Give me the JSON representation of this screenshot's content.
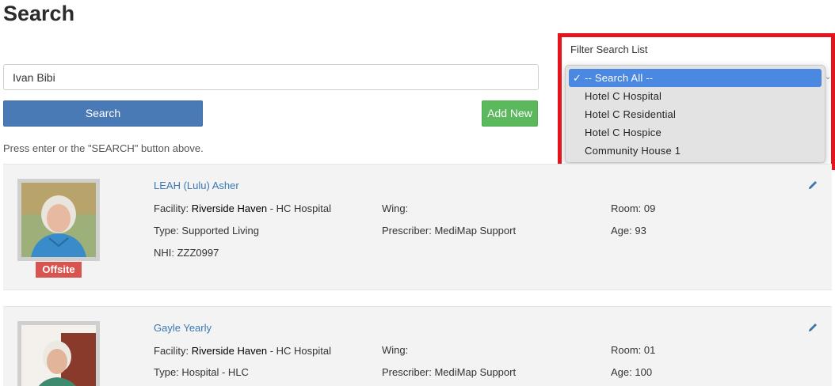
{
  "page": {
    "title": "Search"
  },
  "search": {
    "value": "Ivan Bibi",
    "button_label": "Search",
    "add_label": "Add New",
    "hint": "Press enter or the \"SEARCH\" button above."
  },
  "filter": {
    "label": "Filter Search List",
    "check": "✓",
    "options": [
      "-- Search All --",
      "Hotel C Hospital",
      "Hotel C Residential",
      "Hotel C Hospice",
      "Community House 1"
    ],
    "selected": "-- Search All --",
    "highlight_color": "#e5141c"
  },
  "results": [
    {
      "name": "LEAH (Lulu) Asher",
      "facility_label": "Facility:",
      "facility_name": "Riverside Haven",
      "facility_suffix": "- HC Hospital",
      "wing": "Wing:",
      "room": "Room: 09",
      "type": "Type: Supported Living",
      "prescriber": "Prescriber: MediMap Support",
      "age": "Age: 93",
      "nhi": "NHI: ZZZ0997",
      "badge": "Offsite"
    },
    {
      "name": "Gayle Yearly",
      "facility_label": "Facility:",
      "facility_name": "Riverside Haven",
      "facility_suffix": "- HC Hospital",
      "wing": "Wing:",
      "room": "Room: 01",
      "type": "Type: Hospital - HLC",
      "prescriber": "Prescriber: MediMap Support",
      "age": "Age: 100"
    }
  ],
  "colors": {
    "primary": "#4a7ab5",
    "success": "#5cb85c",
    "danger": "#d9534f",
    "link": "#3a78b5",
    "selected": "#4a88e2"
  },
  "icons": {
    "edit": "pencil-icon",
    "dropdown": "chevron-icon"
  }
}
